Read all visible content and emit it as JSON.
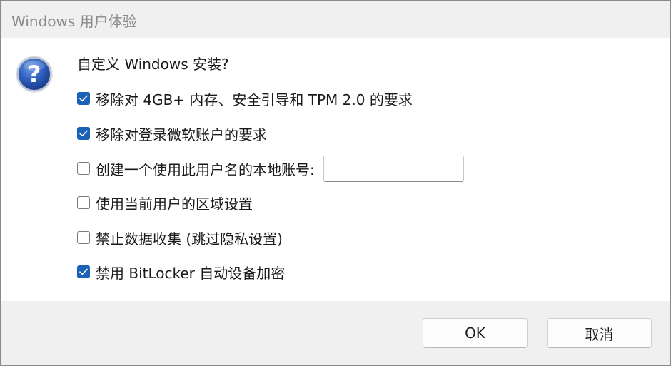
{
  "window": {
    "title": "Windows 用户体验"
  },
  "dialog": {
    "prompt": "自定义 Windows 安装?",
    "icon": "question-icon",
    "options": [
      {
        "label": "移除对 4GB+ 内存、安全引导和 TPM 2.0 的要求",
        "checked": true
      },
      {
        "label": "移除对登录微软账户的要求",
        "checked": true
      },
      {
        "label": "创建一个使用此用户名的本地账号:",
        "checked": false
      },
      {
        "label": "使用当前用户的区域设置",
        "checked": false
      },
      {
        "label": "禁止数据收集 (跳过隐私设置)",
        "checked": false
      },
      {
        "label": "禁用 BitLocker 自动设备加密",
        "checked": true
      }
    ],
    "username_input": {
      "value": ""
    }
  },
  "buttons": {
    "ok_label": "OK",
    "cancel_label": "取消"
  },
  "colors": {
    "accent": "#1a62b8",
    "titlebar_bg": "#f0f0f0",
    "footer_bg": "#f0f0f0"
  }
}
